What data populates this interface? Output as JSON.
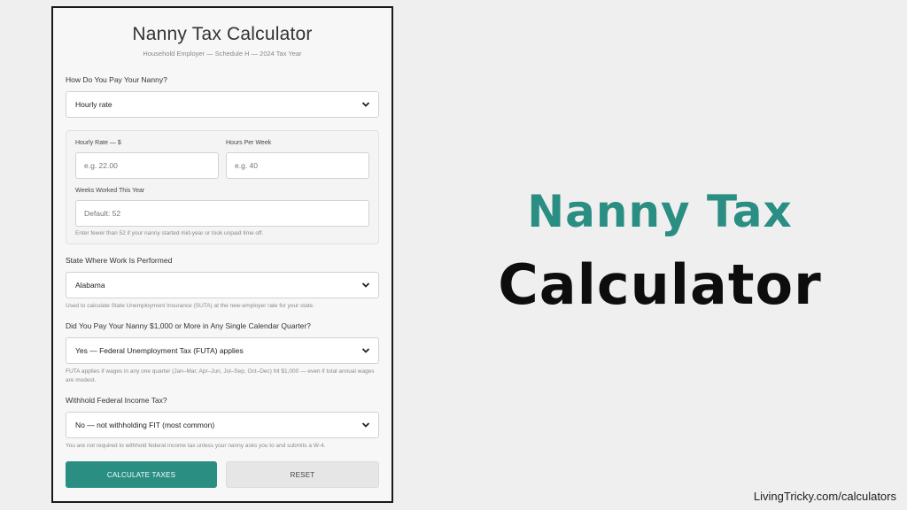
{
  "card": {
    "title": "Nanny Tax Calculator",
    "subtitle": "Household Employer — Schedule H — 2024 Tax Year"
  },
  "pay_method": {
    "label": "How Do You Pay Your Nanny?",
    "value": "Hourly rate"
  },
  "hourly": {
    "rate_label": "Hourly Rate — $",
    "rate_placeholder": "e.g. 22.00",
    "hours_label": "Hours Per Week",
    "hours_placeholder": "e.g. 40",
    "weeks_label": "Weeks Worked This Year",
    "weeks_placeholder": "Default: 52",
    "weeks_hint": "Enter fewer than 52 if your nanny started mid-year or took unpaid time off."
  },
  "state": {
    "label": "State Where Work Is Performed",
    "value": "Alabama",
    "hint": "Used to calculate State Unemployment Insurance (SUTA) at the new-employer rate for your state."
  },
  "futa": {
    "label": "Did You Pay Your Nanny $1,000 or More in Any Single Calendar Quarter?",
    "value": "Yes — Federal Unemployment Tax (FUTA) applies",
    "hint": "FUTA applies if wages in any one quarter (Jan–Mar, Apr–Jun, Jul–Sep, Oct–Dec) hit $1,000 — even if total annual wages are modest."
  },
  "fit": {
    "label": "Withhold Federal Income Tax?",
    "value": "No — not withholding FIT (most common)",
    "hint": "You are not required to withhold federal income tax unless your nanny asks you to and submits a W-4."
  },
  "buttons": {
    "calculate": "CALCULATE TAXES",
    "reset": "RESET"
  },
  "hero": {
    "line1": "Nanny Tax",
    "line2": "Calculator"
  },
  "footer": {
    "url": "LivingTricky.com/calculators"
  },
  "colors": {
    "accent": "#2a8e83",
    "background": "#efefef"
  },
  "icons": {
    "select_chevron": "chevron-down-icon"
  }
}
